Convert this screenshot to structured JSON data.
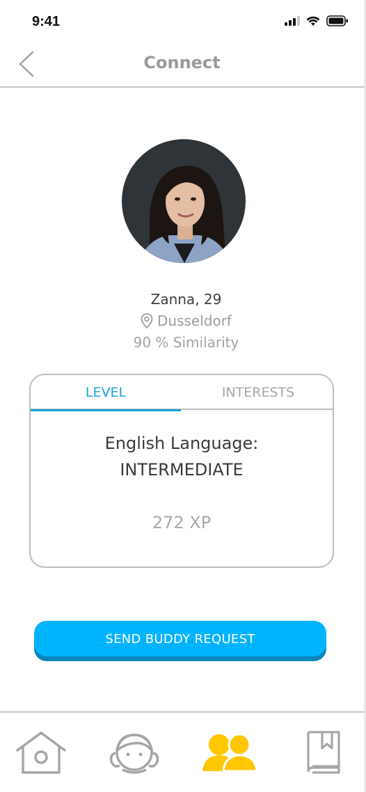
{
  "status_bar": {
    "time": "9:41"
  },
  "header": {
    "title": "Connect",
    "back_icon": "chevron-left-icon"
  },
  "profile": {
    "name_age": "Zanna, 29",
    "location": "Dusseldorf",
    "similarity": "90 % Similarity"
  },
  "card": {
    "tabs": [
      {
        "label": "LEVEL",
        "active": true
      },
      {
        "label": "INTERESTS",
        "active": false
      }
    ],
    "level_line1": "English Language:",
    "level_line2": "INTERMEDIATE",
    "xp": "272 XP"
  },
  "actions": {
    "send_request_label": "SEND BUDDY REQUEST"
  },
  "bottom_nav": {
    "items": [
      {
        "icon": "home-icon",
        "active": false
      },
      {
        "icon": "profile-icon",
        "active": false
      },
      {
        "icon": "buddies-icon",
        "active": true
      },
      {
        "icon": "bookmark-book-icon",
        "active": false
      }
    ]
  },
  "colors": {
    "accent": "#19a3d8",
    "button": "#00b3ff",
    "button_shadow": "#0a86bf",
    "nav_active": "#ffc700",
    "nav_inactive": "#a6a6a6"
  }
}
